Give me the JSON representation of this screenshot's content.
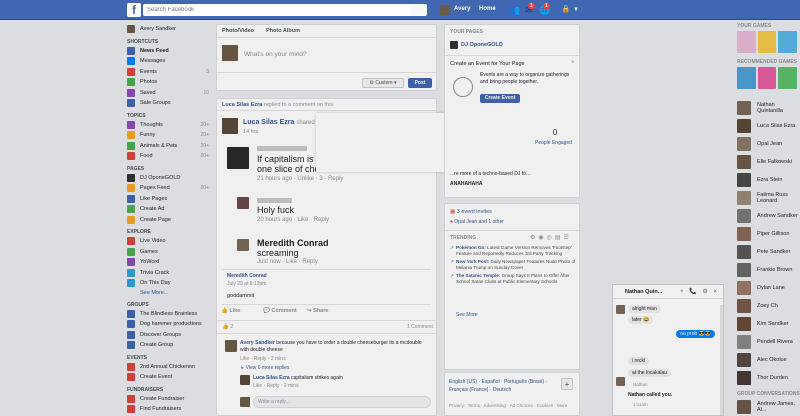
{
  "topbar": {
    "logo": "f",
    "search_placeholder": "Search Facebook",
    "user_name": "Avery",
    "home_label": "Home",
    "badge_messages": "1",
    "badge_notifications": "1"
  },
  "left_nav": {
    "user": "Avery Sandker",
    "shortcuts_heading": "SHORTCUTS",
    "shortcuts": [
      {
        "label": "News Feed",
        "count": "",
        "color": "#4267b2"
      },
      {
        "label": "Messages",
        "count": "",
        "color": "#0084ff"
      },
      {
        "label": "Events",
        "count": "3",
        "color": "#e0433c"
      },
      {
        "label": "Photos",
        "count": "",
        "color": "#4caf50"
      },
      {
        "label": "Saved",
        "count": "10",
        "color": "#8c4bbf"
      },
      {
        "label": "Sale Groups",
        "count": "",
        "color": "#4267b2"
      }
    ],
    "topics_heading": "TOPICS",
    "topics": [
      {
        "label": "Thoughts",
        "count": "20+",
        "color": "#8c4bbf"
      },
      {
        "label": "Funny",
        "count": "20+",
        "color": "#f5a623"
      },
      {
        "label": "Animals & Pets",
        "count": "20+",
        "color": "#4caf50"
      },
      {
        "label": "Food",
        "count": "20+",
        "color": "#e0433c"
      }
    ],
    "pages_heading": "PAGES",
    "pages": [
      {
        "label": "DJ OponeGOLD",
        "count": "",
        "color": "#333"
      },
      {
        "label": "Pages Feed",
        "count": "20+",
        "color": "#f5a623"
      },
      {
        "label": "Like Pages",
        "count": "",
        "color": "#4267b2"
      },
      {
        "label": "Create Ad",
        "count": "",
        "color": "#4caf50"
      },
      {
        "label": "Create Page",
        "count": "",
        "color": "#f5a623"
      }
    ],
    "explore_heading": "EXPLORE",
    "explore": [
      {
        "label": "Live Video",
        "count": "",
        "color": "#e0433c"
      },
      {
        "label": "Games",
        "count": "",
        "color": "#4caf50"
      },
      {
        "label": "YoWord",
        "count": "",
        "color": "#8c4bbf"
      },
      {
        "label": "Trivia Crack",
        "count": "",
        "color": "#2ba4d8"
      },
      {
        "label": "On This Day",
        "count": "",
        "color": "#2ba4d8"
      }
    ],
    "explore_more": "See More...",
    "groups_heading": "GROUPS",
    "groups": [
      {
        "label": "The Blindless Brainless",
        "count": "",
        "color": "#4267b2"
      },
      {
        "label": "Dog hammer productions",
        "count": "",
        "color": "#4267b2"
      },
      {
        "label": "Discover Groups",
        "count": "",
        "color": "#4267b2"
      },
      {
        "label": "Create Group",
        "count": "",
        "color": "#4267b2"
      }
    ],
    "events_heading": "EVENTS",
    "events": [
      {
        "label": "2nd Annual Chickennn",
        "count": "",
        "color": "#e0433c"
      },
      {
        "label": "Create Event",
        "count": "",
        "color": "#e0433c"
      }
    ],
    "fundraisers_heading": "FUNDRAISERS",
    "fundraisers": [
      {
        "label": "Create Fundraiser",
        "count": "",
        "color": "#e0433c"
      },
      {
        "label": "Find Fundraisers",
        "count": "",
        "color": "#e0433c"
      }
    ]
  },
  "composer": {
    "tab_photo_video": "Photo/Video",
    "tab_photo_album": "Photo Album",
    "placeholder": "What's on your mind?",
    "audience": "Custom",
    "post_button": "Post"
  },
  "feed_post": {
    "header_name": "Luca Silas Ezra",
    "header_text": "replied to a comment on this.",
    "author": "Luca Silas Ezra",
    "author_suffix": "shared",
    "time": "14 hrs",
    "comments": [
      {
        "name": "",
        "text": "If capitalism is s",
        "text2": "one slice of chee",
        "meta": "21 hours ago · Unlike · 3 · Reply"
      },
      {
        "name": "",
        "text": "Holy fuck",
        "meta": "20 hours ago · Like · Reply"
      },
      {
        "name": "Meredith Conrad",
        "text": "screaming",
        "meta": "Just now · Like · Reply"
      }
    ],
    "shared_name": "Meredith Conrad",
    "shared_date": "July 29 at 6:13pm",
    "shared_text": "goddammit",
    "actions": {
      "like": "Like",
      "comment": "Comment",
      "share": "Share"
    },
    "reactions_count": "2",
    "comment_count": "1 Comment",
    "reply1_author": "Avery Sandker",
    "reply1_text": "because you have to order a double cheeseburger its a mcdouble with double cheese",
    "reply1_meta": "Like · Reply · 2 mins",
    "view_replies": "View 6 more replies",
    "reply2_author": "Luca Silas Ezra",
    "reply2_text": "capitalism strikes again",
    "reply2_meta": "Like · Reply · 2 mins",
    "write_reply": "Write a reply..."
  },
  "your_pages": {
    "heading": "YOUR PAGES",
    "page_name": "DJ OponeGOLD",
    "create_event_title": "Create an Event for Your Page",
    "create_event_desc": "Events are a way to organize gatherings and bring people together.",
    "create_event_button": "Create Event",
    "stat_value": "0",
    "stat_label": "People Engaged",
    "promo_text": "...re more of a techno-based DJ fo...",
    "promo_name": "ANAHAHAHA"
  },
  "events_box": {
    "title": "3 event invites",
    "subtitle": "Opal Jean and 1 other"
  },
  "trending": {
    "heading": "TRENDING",
    "items": [
      {
        "topic": "Pokémon Go",
        "desc": "Latest Game Version Removes 'Footstep' Feature and Reportedly Reduces 3rd Party Tracking"
      },
      {
        "topic": "New York Post",
        "desc": "Daily Newspaper Features Nude Photo of Melania Trump on Sunday Cover"
      },
      {
        "topic": "The Satanic Temple",
        "desc": "Group Says It Plans to Offer After School Satan Clubs at Public Elementary Schools"
      }
    ],
    "see_more": "See More"
  },
  "languages": {
    "line1": "English (US) · Español · Português (Brasil) ·",
    "line2": "Français (France) · Deutsch",
    "footer": "Privacy · Terms · Advertising · Ad Choices · Cookies · More"
  },
  "right_sidebar": {
    "your_games": "YOUR GAMES",
    "recommended": "RECOMMENDED GAMES",
    "contacts": [
      {
        "name": "Nathan Quintanilla",
        "color": "#7a6a5a"
      },
      {
        "name": "Luca Silas Ezra",
        "color": "#5a4a3a"
      },
      {
        "name": "Opal Jean",
        "color": "#8a7a6a"
      },
      {
        "name": "Elle Falkowski",
        "color": "#6a5a4a"
      },
      {
        "name": "Ezra Stein",
        "color": "#4a4a4a"
      },
      {
        "name": "Fatima Russ Leonard",
        "color": "#9a8a7a"
      },
      {
        "name": "Andrew Sandker",
        "color": "#7a7a7a"
      },
      {
        "name": "Piper Gillison",
        "color": "#8a6a5a"
      },
      {
        "name": "Pete Sandker",
        "color": "#5a5a5a"
      },
      {
        "name": "Frankie Brown",
        "color": "#6a6a6a"
      },
      {
        "name": "Dylan Lane",
        "color": "#9a7a6a"
      },
      {
        "name": "Zoey Ch",
        "color": "#7a5a4a"
      },
      {
        "name": "Kim Sandker",
        "color": "#6a4a3a"
      },
      {
        "name": "Pendell Rivera",
        "color": "#8a8a8a"
      },
      {
        "name": "Alec Okolue",
        "color": "#5a4a4a"
      },
      {
        "name": "Thor Durden",
        "color": "#4a3a3a"
      }
    ],
    "group_conversations": "GROUP CONVERSATIONS",
    "group_contact": "Andrew James, Al..."
  },
  "chat": {
    "name": "Nathan Quin...",
    "messages": [
      {
        "text": "alright man",
        "side": "left"
      },
      {
        "text": "later 😂",
        "side": "left"
      },
      {
        "text": "no prob 😎😎",
        "side": "right"
      },
      {
        "text": "i reckl",
        "side": "left"
      },
      {
        "text": "at the locakalau",
        "side": "left"
      },
      {
        "text": "Nathan",
        "side": "label"
      },
      {
        "text": "Nathan called you.",
        "side": "call"
      },
      {
        "text": "1:11am",
        "side": "callsub"
      }
    ]
  }
}
